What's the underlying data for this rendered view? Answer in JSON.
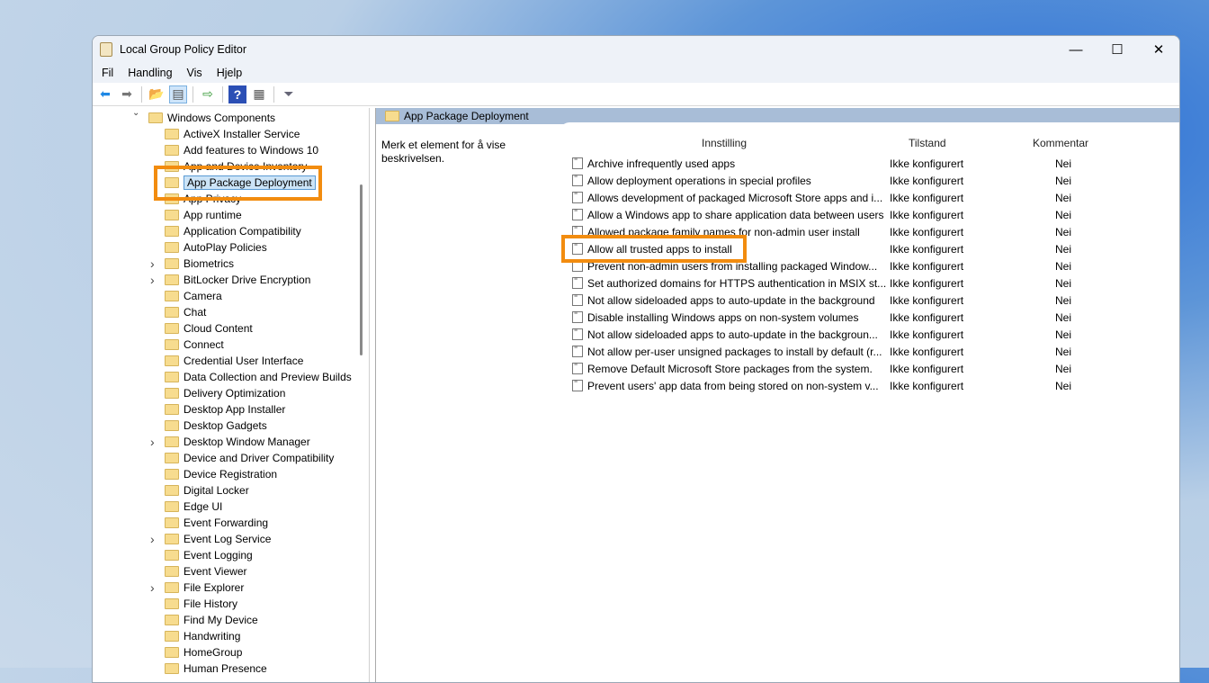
{
  "window": {
    "title": "Local Group Policy Editor",
    "controls": [
      "—",
      "☐",
      "✕"
    ]
  },
  "menu": [
    "Fil",
    "Handling",
    "Vis",
    "Hjelp"
  ],
  "toolbar": [
    {
      "name": "back-icon",
      "g": "⬅",
      "c": "#1e88e5"
    },
    {
      "name": "forward-icon",
      "g": "➡",
      "c": "#777"
    },
    {
      "name": "up-folder-icon",
      "g": "📂",
      "c": "#c9a13c"
    },
    {
      "name": "show-hide-tree-icon",
      "g": "▤",
      "c": "#555"
    },
    {
      "name": "export-list-icon",
      "g": "⇨",
      "c": "#3a9b3a"
    },
    {
      "name": "help-icon",
      "g": "?",
      "c": "#fff"
    },
    {
      "name": "properties-icon",
      "g": "▦",
      "c": "#555"
    },
    {
      "name": "filter-icon",
      "g": "⏷",
      "c": "#667"
    }
  ],
  "tree": {
    "root": "Windows Components",
    "items": [
      "ActiveX Installer Service",
      "Add features to Windows 10",
      "App and Device Inventory",
      "App Package Deployment",
      "App Privacy",
      "App runtime",
      "Application Compatibility",
      "AutoPlay Policies",
      "Biometrics",
      "BitLocker Drive Encryption",
      "Camera",
      "Chat",
      "Cloud Content",
      "Connect",
      "Credential User Interface",
      "Data Collection and Preview Builds",
      "Delivery Optimization",
      "Desktop App Installer",
      "Desktop Gadgets",
      "Desktop Window Manager",
      "Device and Driver Compatibility",
      "Device Registration",
      "Digital Locker",
      "Edge UI",
      "Event Forwarding",
      "Event Log Service",
      "Event Logging",
      "Event Viewer",
      "File Explorer",
      "File History",
      "Find My Device",
      "Handwriting",
      "HomeGroup",
      "Human Presence"
    ],
    "expandable": [
      8,
      9,
      19,
      25,
      28
    ],
    "selected": 3
  },
  "right": {
    "header": "App Package Deployment",
    "description": "Merk et element for å vise beskrivelsen.",
    "columns": {
      "setting": "Innstilling",
      "state": "Tilstand",
      "comment": "Kommentar"
    },
    "rows": [
      {
        "name": "Archive infrequently used apps",
        "state": "Ikke konfigurert",
        "comment": "Nei"
      },
      {
        "name": "Allow deployment operations in special profiles",
        "state": "Ikke konfigurert",
        "comment": "Nei"
      },
      {
        "name": "Allows development of packaged Microsoft Store apps and i...",
        "state": "Ikke konfigurert",
        "comment": "Nei"
      },
      {
        "name": "Allow a Windows app to share application data between users",
        "state": "Ikke konfigurert",
        "comment": "Nei"
      },
      {
        "name": "Allowed package family names for non-admin user install",
        "state": "Ikke konfigurert",
        "comment": "Nei"
      },
      {
        "name": "Allow all trusted apps to install",
        "state": "Ikke konfigurert",
        "comment": "Nei"
      },
      {
        "name": "Prevent non-admin users from installing packaged Window...",
        "state": "Ikke konfigurert",
        "comment": "Nei"
      },
      {
        "name": "Set authorized domains for HTTPS authentication in MSIX st...",
        "state": "Ikke konfigurert",
        "comment": "Nei"
      },
      {
        "name": "Not allow sideloaded apps to auto-update in the background",
        "state": "Ikke konfigurert",
        "comment": "Nei"
      },
      {
        "name": "Disable installing Windows apps on non-system volumes",
        "state": "Ikke konfigurert",
        "comment": "Nei"
      },
      {
        "name": "Not allow sideloaded apps to auto-update in the backgroun...",
        "state": "Ikke konfigurert",
        "comment": "Nei"
      },
      {
        "name": "Not allow per-user unsigned packages to install by default (r...",
        "state": "Ikke konfigurert",
        "comment": "Nei"
      },
      {
        "name": "Remove Default Microsoft Store packages from the system.",
        "state": "Ikke konfigurert",
        "comment": "Nei"
      },
      {
        "name": "Prevent users' app data from being stored on non-system v...",
        "state": "Ikke konfigurert",
        "comment": "Nei"
      }
    ],
    "highlighted": 5
  },
  "colors": {
    "highlight": "#f28c0f",
    "header": "#a8bdd7"
  }
}
